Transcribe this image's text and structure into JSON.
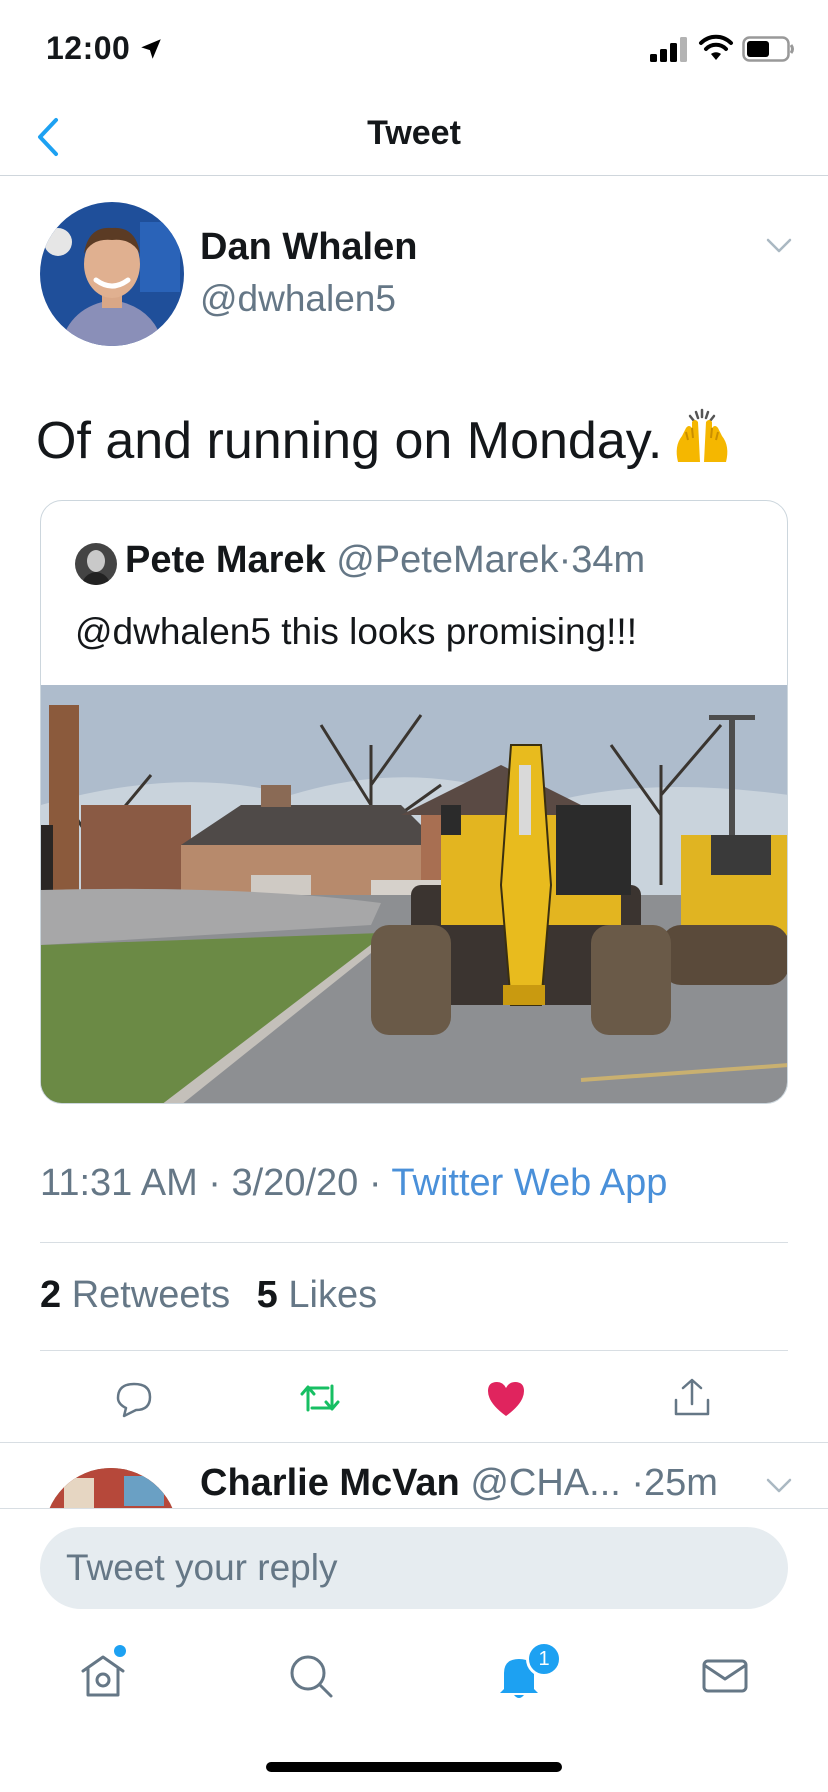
{
  "status_bar": {
    "time": "12:00",
    "icons": [
      "location-arrow-icon",
      "cellular-signal-icon",
      "wifi-icon",
      "battery-icon"
    ]
  },
  "header": {
    "title": "Tweet",
    "back_icon": "chevron-left-icon"
  },
  "tweet": {
    "author_name": "Dan Whalen",
    "author_handle": "@dwhalen5",
    "text": "Of and running on Monday.",
    "emoji": "raising-hands-emoji",
    "timestamp": "11:31 AM",
    "date": "3/20/20",
    "separator": "·",
    "source": "Twitter Web App"
  },
  "quoted_tweet": {
    "author_name": "Pete Marek",
    "author_handle": "@PeteMarek",
    "separator": "·",
    "age": "34m",
    "text": "@dwhalen5 this looks promising!!!",
    "image": "excavator-photo"
  },
  "stats": {
    "retweets_count": "2",
    "retweets_label": "Retweets",
    "likes_count": "5",
    "likes_label": "Likes"
  },
  "actions": {
    "icons": [
      "reply-icon",
      "retweet-icon",
      "like-heart-icon",
      "share-icon"
    ],
    "colors": {
      "retweet": "#17bf63",
      "like": "#e0245e",
      "default": "#657786"
    }
  },
  "reply_preview": {
    "author_name": "Charlie McVan",
    "author_handle": "@CHA...",
    "separator": "·",
    "age": "25m"
  },
  "compose": {
    "placeholder": "Tweet your reply"
  },
  "tab_bar": {
    "items": [
      "home-icon",
      "search-icon",
      "notifications-icon",
      "messages-icon"
    ],
    "notifications_badge": "1"
  },
  "colors": {
    "accent": "#1da1f2",
    "link": "#4a90d9",
    "secondary_text": "#657786"
  }
}
